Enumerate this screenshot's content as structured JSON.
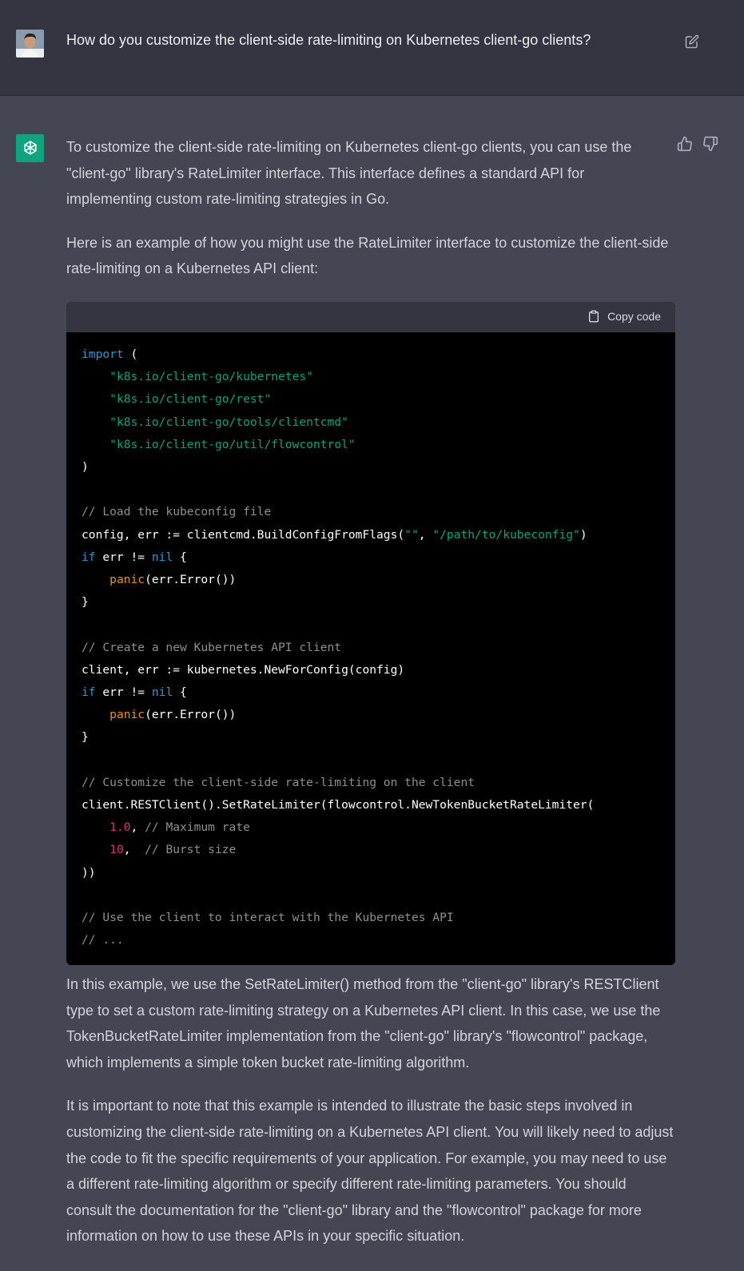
{
  "user_message": "How do you customize the client-side rate-limiting on Kubernetes client-go clients?",
  "answer": {
    "p1": "To customize the client-side rate-limiting on Kubernetes client-go clients, you can use the \"client-go\" library's RateLimiter interface. This interface defines a standard API for implementing custom rate-limiting strategies in Go.",
    "p2": "Here is an example of how you might use the RateLimiter interface to customize the client-side rate-limiting on a Kubernetes API client:",
    "p3": "In this example, we use the SetRateLimiter() method from the \"client-go\" library's RESTClient type to set a custom rate-limiting strategy on a Kubernetes API client. In this case, we use the TokenBucketRateLimiter implementation from the \"client-go\" library's \"flowcontrol\" package, which implements a simple token bucket rate-limiting algorithm.",
    "p4": "It is important to note that this example is intended to illustrate the basic steps involved in customizing the client-side rate-limiting on a Kubernetes API client. You will likely need to adjust the code to fit the specific requirements of your application. For example, you may need to use a different rate-limiting algorithm or specify different rate-limiting parameters. You should consult the documentation for the \"client-go\" library and the \"flowcontrol\" package for more information on how to use these APIs in your specific situation."
  },
  "code_block": {
    "copy_label": "Copy code",
    "lines": [
      [
        [
          "kw",
          "import"
        ],
        [
          "t",
          " ("
        ]
      ],
      [
        [
          "t",
          "    "
        ],
        [
          "str",
          "\"k8s.io/client-go/kubernetes\""
        ]
      ],
      [
        [
          "t",
          "    "
        ],
        [
          "str",
          "\"k8s.io/client-go/rest\""
        ]
      ],
      [
        [
          "t",
          "    "
        ],
        [
          "str",
          "\"k8s.io/client-go/tools/clientcmd\""
        ]
      ],
      [
        [
          "t",
          "    "
        ],
        [
          "str",
          "\"k8s.io/client-go/util/flowcontrol\""
        ]
      ],
      [
        [
          "t",
          ")"
        ]
      ],
      [
        [
          "t",
          ""
        ]
      ],
      [
        [
          "cm",
          "// Load the kubeconfig file"
        ]
      ],
      [
        [
          "t",
          "config, err := clientcmd.BuildConfigFromFlags("
        ],
        [
          "str",
          "\"\""
        ],
        [
          "t",
          ", "
        ],
        [
          "str",
          "\"/path/to/kubeconfig\""
        ],
        [
          "t",
          ")"
        ]
      ],
      [
        [
          "kw",
          "if"
        ],
        [
          "t",
          " err != "
        ],
        [
          "kw",
          "nil"
        ],
        [
          "t",
          " {"
        ]
      ],
      [
        [
          "t",
          "    "
        ],
        [
          "bi",
          "panic"
        ],
        [
          "t",
          "(err.Error())"
        ]
      ],
      [
        [
          "t",
          "}"
        ]
      ],
      [
        [
          "t",
          ""
        ]
      ],
      [
        [
          "cm",
          "// Create a new Kubernetes API client"
        ]
      ],
      [
        [
          "t",
          "client, err := kubernetes.NewForConfig(config)"
        ]
      ],
      [
        [
          "kw",
          "if"
        ],
        [
          "t",
          " err != "
        ],
        [
          "kw",
          "nil"
        ],
        [
          "t",
          " {"
        ]
      ],
      [
        [
          "t",
          "    "
        ],
        [
          "bi",
          "panic"
        ],
        [
          "t",
          "(err.Error())"
        ]
      ],
      [
        [
          "t",
          "}"
        ]
      ],
      [
        [
          "t",
          ""
        ]
      ],
      [
        [
          "cm",
          "// Customize the client-side rate-limiting on the client"
        ]
      ],
      [
        [
          "t",
          "client.RESTClient().SetRateLimiter(flowcontrol.NewTokenBucketRateLimiter("
        ]
      ],
      [
        [
          "t",
          "    "
        ],
        [
          "num",
          "1.0"
        ],
        [
          "t",
          ", "
        ],
        [
          "cm",
          "// Maximum rate"
        ]
      ],
      [
        [
          "t",
          "    "
        ],
        [
          "num",
          "10"
        ],
        [
          "t",
          ",  "
        ],
        [
          "cm",
          "// Burst size"
        ]
      ],
      [
        [
          "t",
          "))"
        ]
      ],
      [
        [
          "t",
          ""
        ]
      ],
      [
        [
          "cm",
          "// Use the client to interact with the Kubernetes API"
        ]
      ],
      [
        [
          "cm",
          "// ..."
        ]
      ]
    ]
  },
  "colors": {
    "page_bg": "#444654",
    "user_bg": "#343541",
    "assistant_logo": "#10a37f",
    "code_bg": "#000000"
  },
  "icons": {
    "edit": "pencil-square-icon",
    "thumbs_up": "thumbs-up-icon",
    "thumbs_down": "thumbs-down-icon",
    "copy": "clipboard-icon",
    "assistant": "openai-logo-icon"
  }
}
